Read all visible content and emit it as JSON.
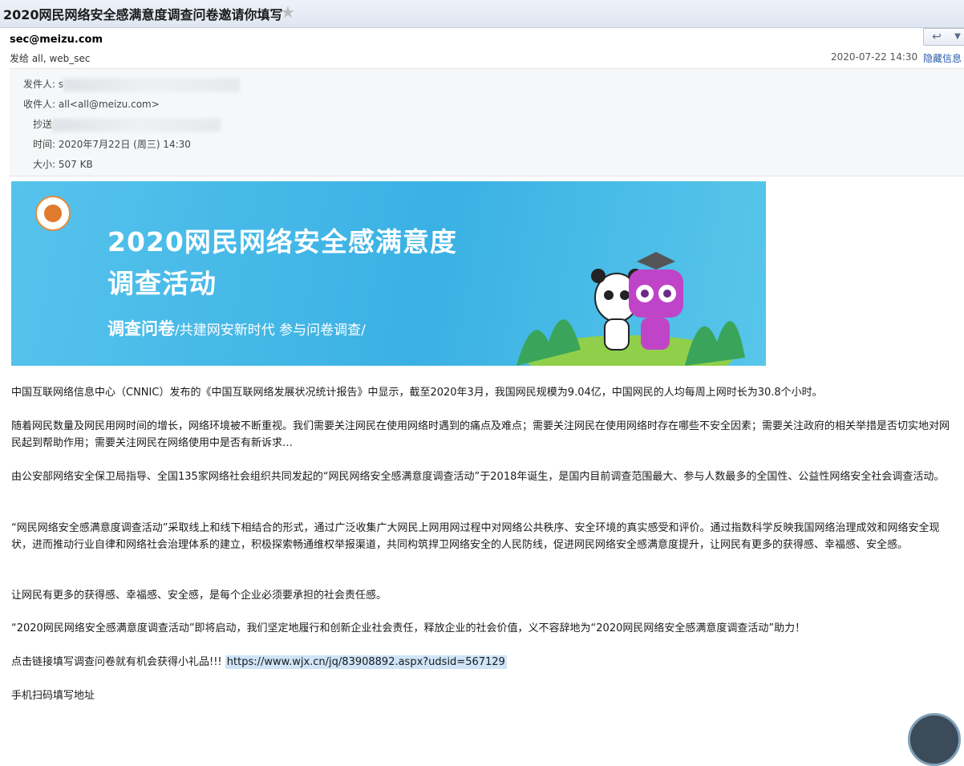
{
  "email": {
    "subject": "2020网民网络安全感满意度调查问卷邀请你填写",
    "from": "sec@meizu.com",
    "to_line": "发给 all, web_sec",
    "date": "2020-07-22 14:30",
    "hide_info": "隐藏信息"
  },
  "details": {
    "sender_label": "发件人:",
    "sender_value": "s",
    "recipient_label": "收件人:",
    "recipient_value": "all<all@meizu.com>",
    "cc_label": "抄送",
    "time_label": "时间:",
    "time_value": "2020年7月22日 (周三) 14:30",
    "size_label": "大小:",
    "size_value": "507 KB"
  },
  "banner": {
    "title_line1": "2020网民网络安全感满意度",
    "title_line2": "调查活动",
    "sub_bold": "调查问卷",
    "sub_rest": "/共建网安新时代 参与问卷调查/"
  },
  "body": {
    "p1": "中国互联网络信息中心（CNNIC）发布的《中国互联网络发展状况统计报告》中显示，截至2020年3月，我国网民规模为9.04亿，中国网民的人均每周上网时长为30.8个小时。",
    "p2": "随着网民数量及网民用网时间的增长，网络环境被不断重视。我们需要关注网民在使用网络时遇到的痛点及难点；需要关注网民在使用网络时存在哪些不安全因素；需要关注政府的相关举措是否切实地对网民起到帮助作用；需要关注网民在网络使用中是否有新诉求…",
    "p3": "由公安部网络安全保卫局指导、全国135家网络社会组织共同发起的“网民网络安全感满意度调查活动”于2018年诞生，是国内目前调查范围最大、参与人数最多的全国性、公益性网络安全社会调查活动。",
    "p4": "“网民网络安全感满意度调查活动”采取线上和线下相结合的形式，通过广泛收集广大网民上网用网过程中对网络公共秩序、安全环境的真实感受和评价。通过指数科学反映我国网络治理成效和网络安全现状，进而推动行业自律和网络社会治理体系的建立，积极探索畅通维权举报渠道，共同构筑捍卫网络安全的人民防线，促进网民网络安全感满意度提升，让网民有更多的获得感、幸福感、安全感。",
    "p5": "让网民有更多的获得感、幸福感、安全感，是每个企业必须要承担的社会责任感。",
    "p6": "“2020网民网络安全感满意度调查活动”即将启动，我们坚定地履行和创新企业社会责任，释放企业的社会价值，义不容辞地为“2020网民网络安全感满意度调查活动”助力！",
    "p7_prefix": "点击链接填写调查问卷就有机会获得小礼品!!!",
    "p7_link": "https://www.wjx.cn/jq/83908892.aspx?udsid=567129",
    "p8": "手机扫码填写地址"
  },
  "icons": {
    "star": "star-icon",
    "reply": "reply-icon",
    "more": "chevron-down-icon"
  },
  "colors": {
    "banner_bg": "#3ab1e4",
    "link_highlight": "#cfe4f7",
    "accent_link": "#2a5db0"
  }
}
